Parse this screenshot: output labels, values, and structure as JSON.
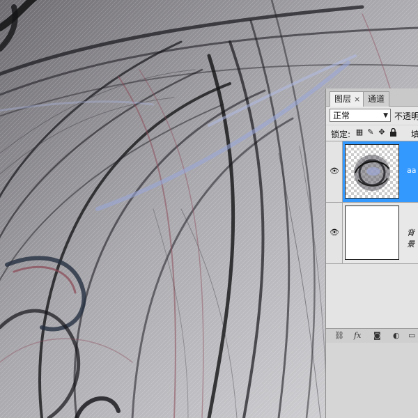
{
  "layers_panel": {
    "tabs": [
      {
        "label": "图层",
        "close": "×"
      },
      {
        "label": "通道"
      }
    ],
    "blend_mode": "正常",
    "opacity_label": "不透明",
    "lock_label": "锁定:",
    "fill_label": "填",
    "layers": [
      {
        "name": "aa",
        "selected": true,
        "thumbnail": "swirl-on-transparency"
      },
      {
        "name": "背景",
        "selected": false,
        "thumbnail": "white"
      }
    ],
    "bottom_icons": [
      "link-icon",
      "fx-icon",
      "mask-icon",
      "adjustment-icon",
      "group-icon"
    ],
    "bottom_fx_label": "fx"
  },
  "colors": {
    "selection": "#3399ff",
    "panel": "#d6d6d6",
    "canvas_background": "#b9b9bc"
  }
}
